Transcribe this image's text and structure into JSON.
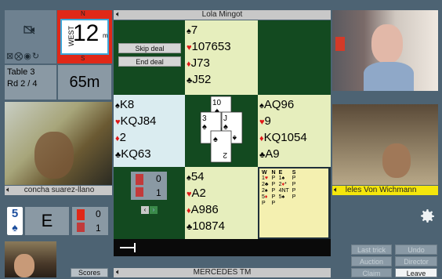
{
  "top_left": {
    "video_off_icon": "video-off-icon",
    "status_icons": [
      "mic-off-icon",
      "mute-icon",
      "eye-icon",
      "refresh-icon"
    ]
  },
  "board": {
    "dealer": "WEST",
    "north": "N",
    "south": "S",
    "number": "12",
    "vulnerable_indicator": "m"
  },
  "table_info": {
    "table": "Table 3",
    "round": "Rd 2 / 4",
    "time_left": "65m"
  },
  "north": {
    "name": "Lola Mingot",
    "hand": [
      {
        "suit": "♠",
        "cls": "suit-s",
        "cards": "7"
      },
      {
        "suit": "♥",
        "cls": "suit-h",
        "cards": "107653"
      },
      {
        "suit": "♦",
        "cls": "suit-d",
        "cards": "J73"
      },
      {
        "suit": "♣",
        "cls": "suit-c",
        "cards": "J52"
      }
    ]
  },
  "deal_buttons": {
    "skip": "Skip deal",
    "end": "End deal"
  },
  "west": {
    "name": "concha suarez-llano",
    "hand": [
      {
        "suit": "♠",
        "cls": "suit-s",
        "cards": "K8"
      },
      {
        "suit": "♥",
        "cls": "suit-h",
        "cards": "KQJ84"
      },
      {
        "suit": "♦",
        "cls": "suit-d",
        "cards": "2"
      },
      {
        "suit": "♣",
        "cls": "suit-c",
        "cards": "KQ63"
      }
    ]
  },
  "east": {
    "name": "leles Von Wichmann",
    "hand": [
      {
        "suit": "♠",
        "cls": "suit-s",
        "cards": "AQ96"
      },
      {
        "suit": "♥",
        "cls": "suit-h",
        "cards": "9"
      },
      {
        "suit": "♦",
        "cls": "suit-d",
        "cards": "KQ1054"
      },
      {
        "suit": "♣",
        "cls": "suit-c",
        "cards": "A9"
      }
    ]
  },
  "south": {
    "name": "MERCEDES TM",
    "hand": [
      {
        "suit": "♠",
        "cls": "suit-s",
        "cards": "54"
      },
      {
        "suit": "♥",
        "cls": "suit-h",
        "cards": "A2"
      },
      {
        "suit": "♦",
        "cls": "suit-d",
        "cards": "A986"
      },
      {
        "suit": "♣",
        "cls": "suit-c",
        "cards": "10874"
      }
    ]
  },
  "trick": {
    "cards": [
      {
        "rank": "10",
        "suit": "♠"
      },
      {
        "rank": "3",
        "suit": "♠"
      },
      {
        "rank": "J",
        "suit": "♠"
      },
      {
        "rank": "2",
        "suit": "♠"
      }
    ]
  },
  "tricks_won": {
    "ns": "0",
    "ew": "1"
  },
  "contract": {
    "level": "5",
    "suit": "♠",
    "declarer": "E",
    "ns_tricks": "0",
    "ew_tricks": "1"
  },
  "auction": {
    "headers": [
      "W",
      "N",
      "E",
      "S"
    ],
    "rows": [
      [
        "1♥",
        "P",
        "1♠",
        "P"
      ],
      [
        "2♣",
        "P",
        "2♦*",
        "P"
      ],
      [
        "2♠",
        "P",
        "4NT",
        "P"
      ],
      [
        "5♦",
        "P",
        "5♠",
        "P"
      ],
      [
        "P",
        "P",
        "",
        ""
      ]
    ]
  },
  "controls": {
    "last_trick": "Last trick",
    "undo": "Undo",
    "auction": "Auction",
    "director": "Director",
    "claim": "Claim",
    "leave": "Leave",
    "scores": "Scores",
    "settings_icon": "gear-icon"
  },
  "colors": {
    "felt": "#134a20",
    "cream": "#e6eebd",
    "background": "#4d6373",
    "name_highlight": "#f4e60c"
  }
}
